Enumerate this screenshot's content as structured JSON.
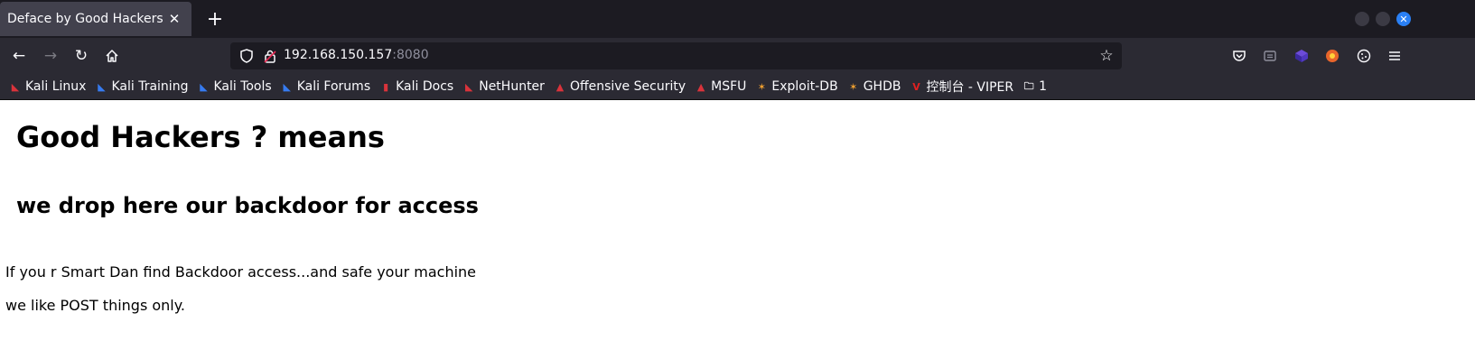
{
  "tab": {
    "title": "Deface by Good Hackers",
    "close": "✕",
    "new": "+"
  },
  "window": {
    "close": "✕"
  },
  "address": {
    "host": "192.168.150.157",
    "port": ":8080"
  },
  "bookmarks": [
    {
      "label": "Kali Linux",
      "icon": "kali-linux-icon",
      "color": "#d9333b",
      "glyph": "◣"
    },
    {
      "label": "Kali Training",
      "icon": "kali-training-icon",
      "color": "#367bf0",
      "glyph": "◣"
    },
    {
      "label": "Kali Tools",
      "icon": "kali-tools-icon",
      "color": "#367bf0",
      "glyph": "◣"
    },
    {
      "label": "Kali Forums",
      "icon": "kali-forums-icon",
      "color": "#367bf0",
      "glyph": "◣"
    },
    {
      "label": "Kali Docs",
      "icon": "kali-docs-icon",
      "color": "#d9333b",
      "glyph": "▮"
    },
    {
      "label": "NetHunter",
      "icon": "nethunter-icon",
      "color": "#d9333b",
      "glyph": "◣"
    },
    {
      "label": "Offensive Security",
      "icon": "offensive-security-icon",
      "color": "#d9333b",
      "glyph": "▲"
    },
    {
      "label": "MSFU",
      "icon": "msfu-icon",
      "color": "#d9333b",
      "glyph": "▲"
    },
    {
      "label": "Exploit-DB",
      "icon": "exploit-db-icon",
      "color": "#f0a030",
      "glyph": "✶"
    },
    {
      "label": "GHDB",
      "icon": "ghdb-icon",
      "color": "#f0a030",
      "glyph": "✶"
    },
    {
      "label": "控制台 - VIPER",
      "icon": "viper-icon",
      "color": "#e02020",
      "glyph": "V"
    },
    {
      "label": "1",
      "icon": "folder-icon",
      "color": "#fbfbfe",
      "glyph": "🗀"
    }
  ],
  "content": {
    "heading": "Good Hackers ? means",
    "subheading": "we drop here our backdoor for access",
    "line1": "If you r Smart Dan find Backdoor access...and safe your machine",
    "line2": "we like POST things only."
  }
}
